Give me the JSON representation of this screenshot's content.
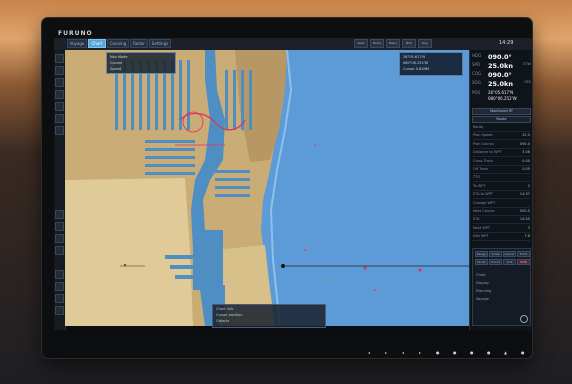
{
  "brand": "FURUNO",
  "tabs": [
    {
      "label": "Voyage",
      "active": false
    },
    {
      "label": "Chart",
      "active": true
    },
    {
      "label": "Conning",
      "active": false
    },
    {
      "label": "Radar",
      "active": false
    },
    {
      "label": "Settings",
      "active": false
    }
  ],
  "top_buttons": [
    "Alert",
    "Mode",
    "Menu",
    "Brill",
    "Day"
  ],
  "time": "14:29",
  "nav": {
    "hdg_label": "HDG",
    "hdg_value": "090.0°",
    "spd_label": "SPD",
    "spd_value": "25.0kn",
    "spd_unit": "STW",
    "cog_label": "COG",
    "cog_value": "090.0°",
    "sog_label": "SOG",
    "sog_value": "25.0kn",
    "sog_unit": "GPS",
    "pos_label": "POS",
    "lat": "26°05.617'N",
    "lon": "080°06.252'W"
  },
  "route_panel": {
    "header": "Monitored RT",
    "subheader": "Route",
    "rows": [
      {
        "label": "Route",
        "value": ""
      },
      {
        "label": "Plan Speed",
        "value": "25.0"
      },
      {
        "label": "Plan Course",
        "value": "090.0"
      },
      {
        "label": "Distance to WPT",
        "value": "3.08"
      },
      {
        "label": "Cross Track",
        "value": "0.00"
      },
      {
        "label": "Off Track",
        "value": "0.05"
      },
      {
        "label": "TTG",
        "value": ""
      },
      {
        "label": "To WPT",
        "value": "2"
      },
      {
        "label": "ETA to WPT",
        "value": "14:37"
      },
      {
        "label": "Change WPT",
        "value": ""
      },
      {
        "label": "Next Course",
        "value": "090.0"
      },
      {
        "label": "ETA",
        "value": "14:45"
      },
      {
        "label": "Next WPT",
        "value": "3"
      },
      {
        "label": "Dist WPT",
        "value": "7.6"
      }
    ]
  },
  "bottom_panel": {
    "buttons": [
      "Range",
      "Scale",
      "Center",
      "Track",
      "Mode",
      "Event",
      "ACK",
      "MOB"
    ],
    "label_1": "Chart",
    "label_2": "Display",
    "label_3": "Planning",
    "label_4": "Voyage"
  },
  "hud": {
    "line1": "Nav Mode",
    "line2": "Course",
    "line3": "Speed"
  },
  "info_box": {
    "line1": "26°05.617'N",
    "line2": "080°06.252'W",
    "line3": "Cursor 0.61NM"
  },
  "msg_box": {
    "line1": "Chart Info",
    "line2": "Cursor position",
    "line3": "Objects"
  },
  "bezel": [
    "◂",
    "▸",
    "◂",
    "▸",
    "●",
    "●",
    "●",
    "●",
    "▲",
    "●"
  ],
  "colors": {
    "sea": "#5c9ad8",
    "land": "#c9ac76",
    "shallow": "#4f8ec2",
    "accent": "#58a6d8",
    "route": "#e03060"
  }
}
